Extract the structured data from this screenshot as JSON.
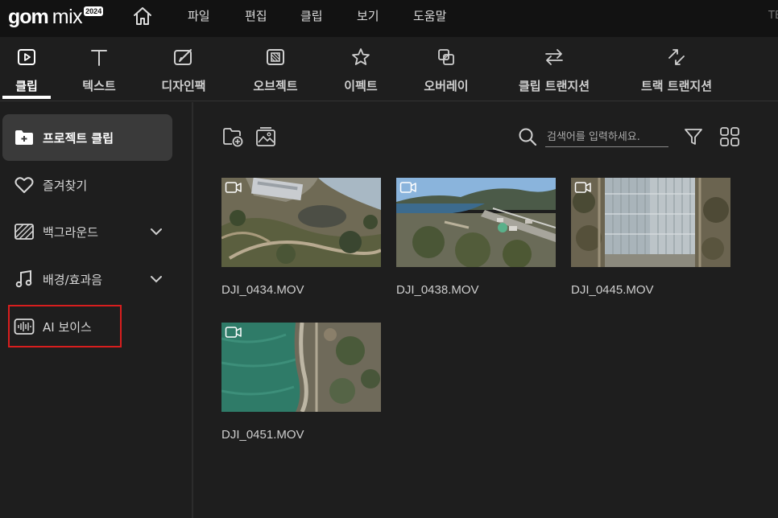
{
  "app": {
    "logo_gom": "gom",
    "logo_mix": "mix",
    "logo_year": "2024",
    "home_icon": "home-icon",
    "menu": [
      {
        "label": "파일"
      },
      {
        "label": "편집"
      },
      {
        "label": "클립"
      },
      {
        "label": "보기"
      },
      {
        "label": "도움말"
      }
    ],
    "menu_tail": "TE"
  },
  "tabs": [
    {
      "label": "클립",
      "icon": "play-square-icon",
      "active": true
    },
    {
      "label": "텍스트",
      "icon": "text-icon"
    },
    {
      "label": "디자인팩",
      "icon": "design-brush-icon"
    },
    {
      "label": "오브젝트",
      "icon": "object-icon"
    },
    {
      "label": "이펙트",
      "icon": "star-icon"
    },
    {
      "label": "오버레이",
      "icon": "overlay-icon"
    },
    {
      "label": "클립 트랜지션",
      "icon": "swap-arrows-icon"
    },
    {
      "label": "트랙 트랜지션",
      "icon": "cross-arrows-icon"
    }
  ],
  "sidebar": {
    "items": [
      {
        "label": "프로젝트 클립",
        "icon": "folder-plus-icon",
        "active": true
      },
      {
        "label": "즐겨찾기",
        "icon": "heart-icon"
      },
      {
        "label": "백그라운드",
        "icon": "background-pattern-icon",
        "expandable": true
      },
      {
        "label": "배경/효과음",
        "icon": "music-note-icon",
        "expandable": true
      },
      {
        "label": "AI 보이스",
        "icon": "ai-voice-waveform-icon",
        "highlighted": true
      }
    ]
  },
  "main": {
    "toolbar": {
      "add_folder_icon": "folder-add-icon",
      "add_image_icon": "image-add-icon",
      "search_placeholder": "검색어를 입력하세요.",
      "filter_icon": "filter-icon",
      "grid_icon": "grid-view-icon"
    },
    "clips": [
      {
        "name": "DJI_0434.MOV",
        "scene": "aerial-park"
      },
      {
        "name": "DJI_0438.MOV",
        "scene": "aerial-coast-town"
      },
      {
        "name": "DJI_0445.MOV",
        "scene": "aerial-greenhouse"
      },
      {
        "name": "DJI_0451.MOV",
        "scene": "aerial-shoreline"
      }
    ]
  },
  "colors": {
    "background": "#1e1e1e",
    "menubar": "#121212",
    "active_item": "#3a3a3a",
    "highlight": "#d81e1e",
    "text": "#d8d8d8"
  }
}
